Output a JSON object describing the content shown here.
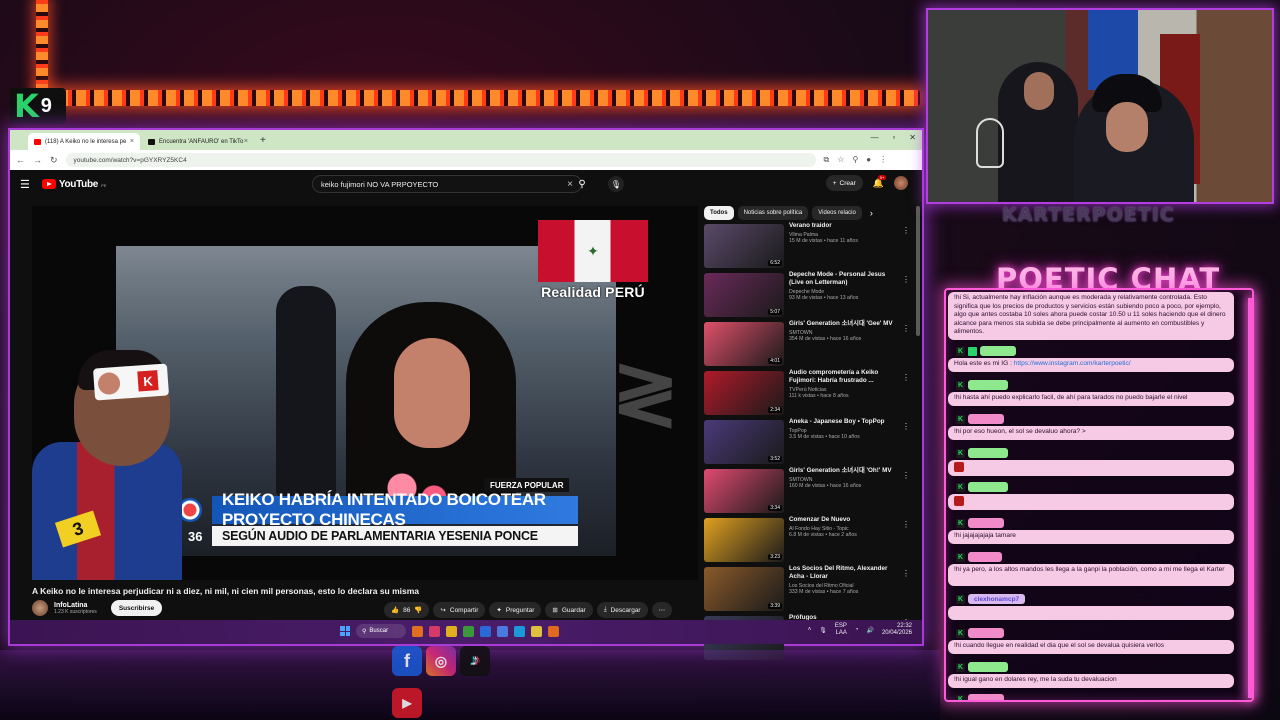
{
  "overlay": {
    "logo_letter": "K",
    "logo_number": "9",
    "brand_name": "KARTERPOETIC",
    "chat_title": "POETIC CHAT"
  },
  "browser": {
    "tabs": [
      {
        "label": "(118) A Keiko no le interesa pe",
        "fav_color": "#ff0000"
      },
      {
        "label": "Encuentra 'ANFAURO' en TikTo",
        "fav_color": "#111111"
      }
    ],
    "new_tab": "+",
    "url": "youtube.com/watch?v=pGYXRYZ5KC4"
  },
  "youtube": {
    "wordmark": "YouTube",
    "region": "PE",
    "search_query": "keiko fujimori NO VA PRPOYECTO",
    "create_label": "Crear",
    "notif_count": "9+",
    "video": {
      "overlay_title": "Realidad PERÚ",
      "tag": "FUERZA POPULAR",
      "headline_1": "KEIKO HABRÍA INTENTADO BOICOTEAR PROYECTO CHINECAS",
      "headline_2": "SEGÚN AUDIO DE PARLAMENTARIA YESENIA PONCE",
      "headline_num": "36",
      "badge_num": "3"
    },
    "title": "A Keiko no le interesa perjudicar ni a diez, ni mil, ni cien mil personas, esto lo declara su misma",
    "channel": "InfoLatina",
    "subscribers": "1.23 K suscriptores",
    "subscribe_label": "Suscribirse",
    "likes": "86",
    "actions": {
      "share": "Compartir",
      "ask": "Preguntar",
      "save": "Guardar",
      "download": "Descargar"
    },
    "chips": [
      "Todos",
      "Noticias sobre política",
      "Videos relacio"
    ],
    "recommendations": [
      {
        "title": "Verano traidor",
        "channel": "Vilma Palma",
        "meta": "15 M de vistas • hace 11 años",
        "duration": "6:52",
        "color": "#5a4a6a"
      },
      {
        "title": "Depeche Mode - Personal Jesus (Live on Letterman)",
        "channel": "Depeche Mode",
        "meta": "93 M de vistas • hace 13 años",
        "duration": "5:07",
        "color": "#6a2a5a"
      },
      {
        "title": "Girls' Generation 소녀시대 'Gee' MV",
        "channel": "SMTOWN",
        "meta": "354 M de vistas • hace 16 años",
        "duration": "4:01",
        "color": "#e0506a"
      },
      {
        "title": "Audio comprometería a Keiko Fujimori: Habría frustrado ...",
        "channel": "TVPerú Noticias",
        "meta": "111 k vistas • hace 8 años",
        "duration": "2:34",
        "color": "#b01a2a"
      },
      {
        "title": "Aneka - Japanese Boy • TopPop",
        "channel": "TopPop",
        "meta": "3.5 M de vistas • hace 10 años",
        "duration": "3:52",
        "color": "#4a3a7a"
      },
      {
        "title": "Girls' Generation 소녀시대 'Oh!' MV",
        "channel": "SMTOWN",
        "meta": "160 M de vistas • hace 16 años",
        "duration": "3:34",
        "color": "#e04a70"
      },
      {
        "title": "Comenzar De Nuevo",
        "channel": "Al Fondo Hay Sitio - Topic",
        "meta": "6.8 M de vistas • hace 2 años",
        "duration": "3:23",
        "color": "#e0a020"
      },
      {
        "title": "Los Socios Del Ritmo, Alexander Acha - Llorar",
        "channel": "Los Socios del Ritmo Oficial",
        "meta": "333 M de vistas • hace 7 años",
        "duration": "3:39",
        "color": "#8a5a2a"
      },
      {
        "title": "Prófugos",
        "channel": "",
        "meta": "",
        "duration": "",
        "color": "#3a3a5a"
      }
    ]
  },
  "taskbar": {
    "search_label": "Buscar",
    "lang_1": "ESP",
    "lang_2": "LAA",
    "time": "22:32",
    "date": "20/04/2026"
  },
  "chat": {
    "messages": [
      {
        "user": "",
        "text": "!hi Si, actualmente hay inflación aunque es moderada y relativamente controlada. Esto significa que los precios de productos y servicios están subiendo poco a poco, por ejemplo, algo que antes costaba 10 soles ahora puede costar 10.50 u 11 soles haciendo que el dinero alcance para menos sta subida se debe principalmente al aumento en combustibles y alimentos."
      },
      {
        "user": "",
        "text": "Hola este es mi IG : ",
        "link": "https://www.instagram.com/karterpoetic/"
      },
      {
        "user": "",
        "text": "!hi hasta ahí puedo explicarlo facil, de ahí para tarados no puedo bajarle el nivel"
      },
      {
        "user": "",
        "text": "!hi por eso hueon, el sol se devaluo ahora? >"
      },
      {
        "user": "",
        "text": ""
      },
      {
        "user": "",
        "text": ""
      },
      {
        "user": "",
        "text": "!hi jajajajajaja tamare"
      },
      {
        "user": "",
        "text": "!hi ya pero, a los altos mandos les llega a la ganpi la población, como a mi me llega el Karter"
      },
      {
        "user": "clexhonamcp7",
        "text": ""
      },
      {
        "user": "",
        "text": "!hi cuando llegue en realidad el dia que el sol se devalua quisiera verlos"
      },
      {
        "user": "",
        "text": "!hi igual gano en dolares rey, me la suda tu devaluacion"
      },
      {
        "user": "",
        "text": "!hi >"
      }
    ]
  },
  "socials": {
    "fb": "f",
    "yt": "▶",
    "ig": "◎",
    "tt": "♪"
  }
}
